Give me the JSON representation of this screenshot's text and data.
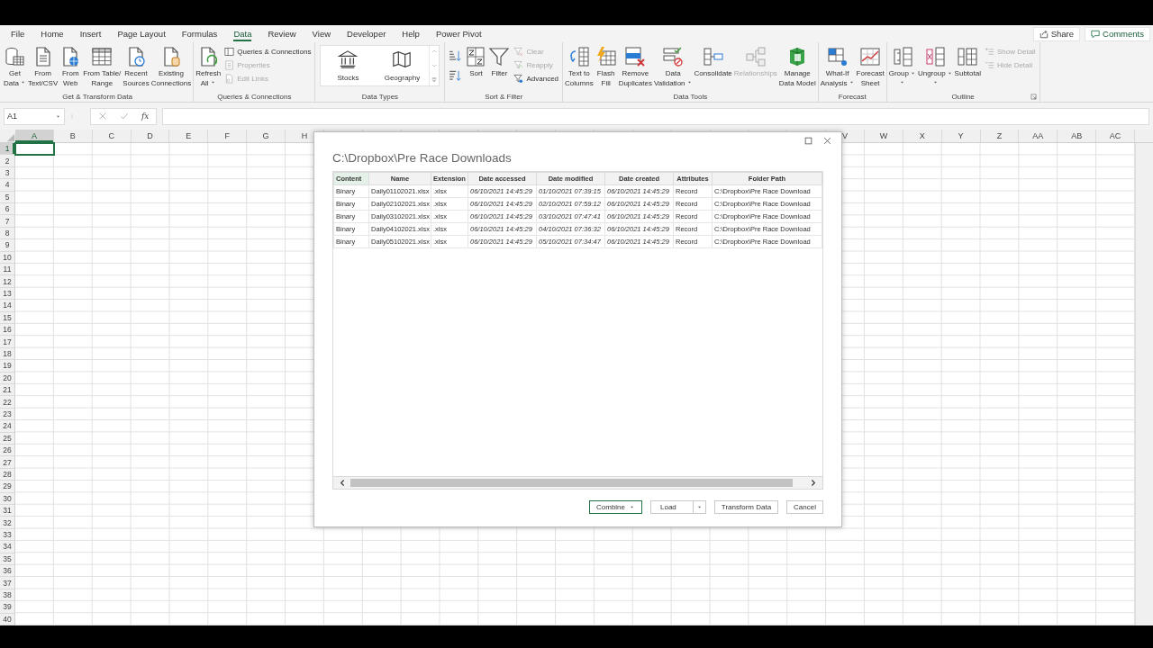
{
  "menu_tabs": [
    {
      "label": "File",
      "selected": false
    },
    {
      "label": "Home",
      "selected": false
    },
    {
      "label": "Insert",
      "selected": false
    },
    {
      "label": "Page Layout",
      "selected": false
    },
    {
      "label": "Formulas",
      "selected": false
    },
    {
      "label": "Data",
      "selected": true
    },
    {
      "label": "Review",
      "selected": false
    },
    {
      "label": "View",
      "selected": false
    },
    {
      "label": "Developer",
      "selected": false
    },
    {
      "label": "Help",
      "selected": false
    },
    {
      "label": "Power Pivot",
      "selected": false
    }
  ],
  "header_buttons": [
    {
      "label": "Share"
    },
    {
      "label": "Comments"
    }
  ],
  "ribbon_groups": [
    {
      "label": "Get & Transform Data",
      "launcher": false,
      "items": [
        {
          "kind": "large",
          "lines": [
            "Get",
            "Data"
          ],
          "dropdown": true,
          "disabled": false
        },
        {
          "kind": "large",
          "lines": [
            "From",
            "Text/CSV"
          ],
          "dropdown": false,
          "disabled": false
        },
        {
          "kind": "large",
          "lines": [
            "From",
            "Web"
          ],
          "dropdown": false,
          "disabled": false
        },
        {
          "kind": "large",
          "lines": [
            "From Table/",
            "Range"
          ],
          "dropdown": false,
          "disabled": false
        },
        {
          "kind": "large",
          "lines": [
            "Recent",
            "Sources"
          ],
          "dropdown": false,
          "disabled": false
        },
        {
          "kind": "large",
          "lines": [
            "Existing",
            "Connections"
          ],
          "dropdown": false,
          "disabled": false
        }
      ]
    },
    {
      "label": "Queries & Connections",
      "launcher": false,
      "items": [
        {
          "kind": "large",
          "lines": [
            "Refresh",
            "All"
          ],
          "dropdown": true,
          "disabled": false
        },
        {
          "kind": "stack",
          "buttons": [
            {
              "label": "Queries & Connections",
              "disabled": false
            },
            {
              "label": "Properties",
              "disabled": true
            },
            {
              "label": "Edit Links",
              "disabled": true
            }
          ]
        }
      ]
    },
    {
      "label": "Data Types",
      "launcher": false,
      "items": [
        {
          "kind": "gallery",
          "options": [
            "Stocks",
            "Geography"
          ]
        }
      ]
    },
    {
      "label": "Sort & Filter",
      "launcher": false,
      "items": [
        {
          "kind": "sort_pair"
        },
        {
          "kind": "large",
          "lines": [
            "Sort"
          ],
          "dropdown": false,
          "disabled": false
        },
        {
          "kind": "large",
          "lines": [
            "Filter"
          ],
          "dropdown": false,
          "disabled": false
        },
        {
          "kind": "stack",
          "buttons": [
            {
              "label": "Clear",
              "disabled": true
            },
            {
              "label": "Reapply",
              "disabled": true
            },
            {
              "label": "Advanced",
              "disabled": false
            }
          ]
        }
      ]
    },
    {
      "label": "Data Tools",
      "launcher": false,
      "items": [
        {
          "kind": "large",
          "lines": [
            "Text to",
            "Columns"
          ],
          "dropdown": false,
          "disabled": false
        },
        {
          "kind": "large",
          "lines": [
            "Flash",
            "Fill"
          ],
          "dropdown": false,
          "disabled": false
        },
        {
          "kind": "large",
          "lines": [
            "Remove",
            "Duplicates"
          ],
          "dropdown": false,
          "disabled": false
        },
        {
          "kind": "large",
          "lines": [
            "Data",
            "Validation"
          ],
          "dropdown": true,
          "disabled": false
        },
        {
          "kind": "large",
          "lines": [
            "Consolidate"
          ],
          "dropdown": false,
          "disabled": false
        },
        {
          "kind": "large",
          "lines": [
            "Relationships"
          ],
          "dropdown": false,
          "disabled": true
        },
        {
          "kind": "large",
          "lines": [
            "Manage",
            "Data Model"
          ],
          "dropdown": false,
          "disabled": false
        }
      ]
    },
    {
      "label": "Forecast",
      "launcher": false,
      "items": [
        {
          "kind": "large",
          "lines": [
            "What-If",
            "Analysis"
          ],
          "dropdown": true,
          "disabled": false
        },
        {
          "kind": "large",
          "lines": [
            "Forecast",
            "Sheet"
          ],
          "dropdown": false,
          "disabled": false
        }
      ]
    },
    {
      "label": "Outline",
      "launcher": true,
      "items": [
        {
          "kind": "large",
          "lines": [
            "Group"
          ],
          "dropdown": true,
          "disabled": false
        },
        {
          "kind": "large",
          "lines": [
            "Ungroup"
          ],
          "dropdown": true,
          "disabled": false
        },
        {
          "kind": "large",
          "lines": [
            "Subtotal"
          ],
          "dropdown": false,
          "disabled": false
        },
        {
          "kind": "stack",
          "buttons": [
            {
              "label": "Show Detail",
              "disabled": true
            },
            {
              "label": "Hide Detail",
              "disabled": true
            }
          ]
        }
      ]
    }
  ],
  "formula_bar": {
    "name_box": "A1",
    "function_label": "fx"
  },
  "sheet": {
    "columns_left": [
      {
        "label": "A",
        "selected": true
      },
      {
        "label": "B",
        "selected": false
      },
      {
        "label": "C",
        "selected": false
      },
      {
        "label": "D",
        "selected": false
      },
      {
        "label": "E",
        "selected": false
      },
      {
        "label": "F",
        "selected": false
      },
      {
        "label": "G",
        "selected": false
      },
      {
        "label": "H",
        "selected": false
      }
    ],
    "columns_right": [
      {
        "label": "V",
        "selected": false
      },
      {
        "label": "W",
        "selected": false
      },
      {
        "label": "X",
        "selected": false
      },
      {
        "label": "Y",
        "selected": false
      },
      {
        "label": "Z",
        "selected": false
      },
      {
        "label": "AA",
        "selected": false
      },
      {
        "label": "AB",
        "selected": false
      },
      {
        "label": "AC",
        "selected": false
      }
    ],
    "rows": [
      {
        "label": "1",
        "selected": true
      },
      {
        "label": "2",
        "selected": false
      },
      {
        "label": "3",
        "selected": false
      },
      {
        "label": "4",
        "selected": false
      },
      {
        "label": "5",
        "selected": false
      },
      {
        "label": "6",
        "selected": false
      },
      {
        "label": "7",
        "selected": false
      },
      {
        "label": "8",
        "selected": false
      },
      {
        "label": "9",
        "selected": false
      },
      {
        "label": "10",
        "selected": false
      },
      {
        "label": "11",
        "selected": false
      },
      {
        "label": "12",
        "selected": false
      },
      {
        "label": "13",
        "selected": false
      },
      {
        "label": "14",
        "selected": false
      },
      {
        "label": "15",
        "selected": false
      },
      {
        "label": "16",
        "selected": false
      },
      {
        "label": "17",
        "selected": false
      },
      {
        "label": "18",
        "selected": false
      },
      {
        "label": "19",
        "selected": false
      },
      {
        "label": "20",
        "selected": false
      },
      {
        "label": "21",
        "selected": false
      },
      {
        "label": "22",
        "selected": false
      },
      {
        "label": "23",
        "selected": false
      },
      {
        "label": "24",
        "selected": false
      },
      {
        "label": "25",
        "selected": false
      },
      {
        "label": "26",
        "selected": false
      },
      {
        "label": "27",
        "selected": false
      },
      {
        "label": "28",
        "selected": false
      },
      {
        "label": "29",
        "selected": false
      },
      {
        "label": "30",
        "selected": false
      },
      {
        "label": "31",
        "selected": false
      },
      {
        "label": "32",
        "selected": false
      },
      {
        "label": "33",
        "selected": false
      },
      {
        "label": "34",
        "selected": false
      },
      {
        "label": "35",
        "selected": false
      },
      {
        "label": "36",
        "selected": false
      },
      {
        "label": "37",
        "selected": false
      },
      {
        "label": "38",
        "selected": false
      },
      {
        "label": "39",
        "selected": false
      },
      {
        "label": "40",
        "selected": false
      }
    ]
  },
  "dialog": {
    "title": "C:\\Dropbox\\Pre Race Downloads",
    "columns": [
      {
        "label": "Content",
        "selected": true
      },
      {
        "label": "Name",
        "selected": false
      },
      {
        "label": "Extension",
        "selected": false
      },
      {
        "label": "Date accessed",
        "selected": false
      },
      {
        "label": "Date modified",
        "selected": false
      },
      {
        "label": "Date created",
        "selected": false
      },
      {
        "label": "Attributes",
        "selected": false
      },
      {
        "label": "Folder Path",
        "selected": false
      }
    ],
    "rows": [
      [
        "Binary",
        "Daily01102021.xlsx",
        ".xlsx",
        "06/10/2021 14:45:29",
        "01/10/2021 07:39:15",
        "06/10/2021 14:45:29",
        "Record",
        "C:\\Dropbox\\Pre Race Download"
      ],
      [
        "Binary",
        "Daily02102021.xlsx",
        ".xlsx",
        "06/10/2021 14:45:29",
        "02/10/2021 07:59:12",
        "06/10/2021 14:45:29",
        "Record",
        "C:\\Dropbox\\Pre Race Download"
      ],
      [
        "Binary",
        "Daily03102021.xlsx",
        ".xlsx",
        "06/10/2021 14:45:29",
        "03/10/2021 07:47:41",
        "06/10/2021 14:45:29",
        "Record",
        "C:\\Dropbox\\Pre Race Download"
      ],
      [
        "Binary",
        "Daily04102021.xlsx",
        ".xlsx",
        "06/10/2021 14:45:29",
        "04/10/2021 07:36:32",
        "06/10/2021 14:45:29",
        "Record",
        "C:\\Dropbox\\Pre Race Download"
      ],
      [
        "Binary",
        "Daily05102021.xlsx",
        ".xlsx",
        "06/10/2021 14:45:29",
        "05/10/2021 07:34:47",
        "06/10/2021 14:45:29",
        "Record",
        "C:\\Dropbox\\Pre Race Download"
      ]
    ],
    "buttons": [
      {
        "label": "Combine",
        "kind": "dropdown",
        "focused": true
      },
      {
        "label": "Load",
        "kind": "split",
        "focused": false
      },
      {
        "label": "Transform Data",
        "kind": "plain",
        "focused": false
      },
      {
        "label": "Cancel",
        "kind": "plain",
        "focused": false
      }
    ]
  }
}
